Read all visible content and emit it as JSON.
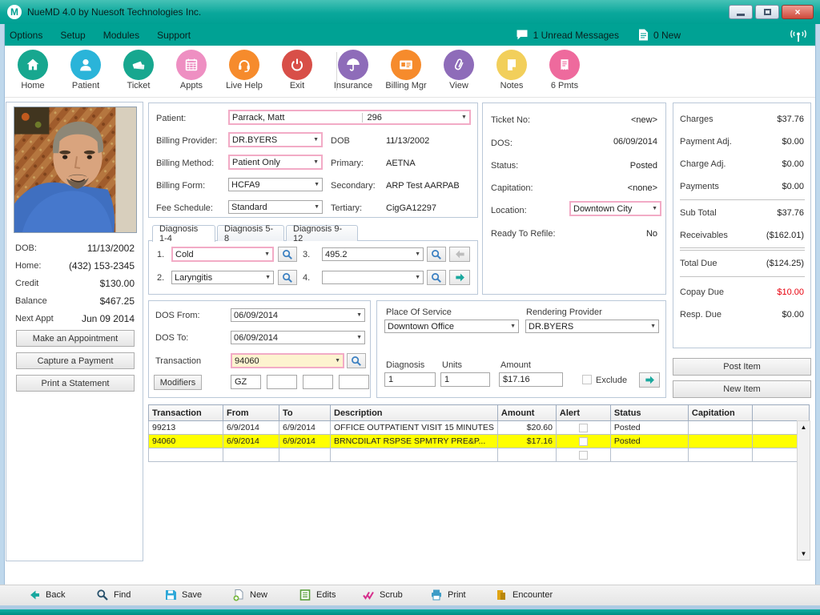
{
  "titlebar": {
    "logo_letter": "M",
    "title": "NueMD 4.0 by Nuesoft Technologies Inc."
  },
  "menubar": {
    "items": [
      "Options",
      "Setup",
      "Modules",
      "Support"
    ],
    "unread": "1 Unread Messages",
    "new_badge": "0 New"
  },
  "toolbar": {
    "items": [
      {
        "label": "Home",
        "color": "#17a78f"
      },
      {
        "label": "Patient",
        "color": "#2ab4d9"
      },
      {
        "label": "Ticket",
        "color": "#17a78f"
      },
      {
        "label": "Appts",
        "color": "#ee8fc2"
      },
      {
        "label": "Live Help",
        "color": "#f68b2c"
      },
      {
        "label": "Exit",
        "color": "#d84f48"
      },
      {
        "label": "Insurance",
        "color": "#8e6cb9"
      },
      {
        "label": "Billing Mgr",
        "color": "#f68b2c"
      },
      {
        "label": "View",
        "color": "#8e6cb9"
      },
      {
        "label": "Notes",
        "color": "#f2cf5b"
      },
      {
        "label": "6 Pmts",
        "color": "#ee6a9d"
      }
    ]
  },
  "sidebar": {
    "dob_label": "DOB:",
    "dob": "11/13/2002",
    "home_label": "Home:",
    "home": "(432) 153-2345",
    "credit_label": "Credit",
    "credit": "$130.00",
    "balance_label": "Balance",
    "balance": "$467.25",
    "next_appt_label": "Next Appt",
    "next_appt": "Jun 09 2014",
    "buttons": [
      "Make an Appointment",
      "Capture a Payment",
      "Print a Statement"
    ]
  },
  "patient_form": {
    "patient_label": "Patient:",
    "patient_name": "Parrack, Matt",
    "patient_number": "296",
    "billing_provider_label": "Billing Provider:",
    "billing_provider": "DR.BYERS",
    "dob_label": "DOB",
    "dob": "11/13/2002",
    "billing_method_label": "Billing Method:",
    "billing_method": "Patient Only",
    "primary_label": "Primary:",
    "primary": "AETNA",
    "billing_form_label": "Billing Form:",
    "billing_form": "HCFA9",
    "secondary_label": "Secondary:",
    "secondary": "ARP Test AARPAB",
    "fee_schedule_label": "Fee Schedule:",
    "fee_schedule": "Standard",
    "tertiary_label": "Tertiary:",
    "tertiary": "CigGA12297"
  },
  "diagnosis": {
    "tabs": [
      "Diagnosis 1-4",
      "Diagnosis 5-8",
      "Diagnosis 9-12"
    ],
    "f1_num": "1.",
    "f1": "Cold",
    "f2_num": "2.",
    "f2": "Laryngitis",
    "f3_num": "3.",
    "f3": "495.2",
    "f4_num": "4.",
    "f4": ""
  },
  "ticket": {
    "ticket_no_label": "Ticket No:",
    "ticket_no": "<new>",
    "dos_label": "DOS:",
    "dos": "06/09/2014",
    "status_label": "Status:",
    "status": "Posted",
    "capitation_label": "Capitation:",
    "capitation": "<none>",
    "location_label": "Location:",
    "location": "Downtown City",
    "refile_label": "Ready To Refile:",
    "refile": "No"
  },
  "financials": {
    "charges_label": "Charges",
    "charges": "$37.76",
    "payment_adj_label": "Payment Adj.",
    "payment_adj": "$0.00",
    "charge_adj_label": "Charge Adj.",
    "charge_adj": "$0.00",
    "payments_label": "Payments",
    "payments": "$0.00",
    "sub_total_label": "Sub Total",
    "sub_total": "$37.76",
    "receivables_label": "Receivables",
    "receivables": "($162.01)",
    "total_due_label": "Total Due",
    "total_due": "($124.25)",
    "copay_due_label": "Copay Due",
    "copay_due": "$10.00",
    "resp_due_label": "Resp. Due",
    "resp_due": "$0.00",
    "post_item": "Post Item",
    "new_item": "New Item"
  },
  "charge": {
    "dos_from_label": "DOS From:",
    "dos_from": "06/09/2014",
    "dos_to_label": "DOS To:",
    "dos_to": "06/09/2014",
    "transaction_label": "Transaction",
    "transaction": "94060",
    "modifiers_label": "Modifiers",
    "modifier_1": "GZ",
    "modifier_2": "",
    "modifier_3": "",
    "modifier_4": "",
    "pos_label": "Place Of Service",
    "pos": "Downtown Office",
    "provider_label": "Rendering Provider",
    "provider": "DR.BYERS",
    "diagnosis_label": "Diagnosis",
    "diagnosis": "1",
    "units_label": "Units",
    "units": "1",
    "amount_label": "Amount",
    "amount": "$17.16",
    "exclude_label": "Exclude"
  },
  "table": {
    "columns": [
      "Transaction",
      "From",
      "To",
      "Description",
      "Amount",
      "Alert",
      "Status",
      "Capitation",
      ""
    ],
    "rows": [
      {
        "transaction": "99213",
        "from": "6/9/2014",
        "to": "6/9/2014",
        "description": "OFFICE OUTPATIENT VISIT 15 MINUTES",
        "amount": "$20.60",
        "status": "Posted",
        "capitation": ""
      },
      {
        "transaction": "94060",
        "from": "6/9/2014",
        "to": "6/9/2014",
        "description": "BRNCDILAT RSPSE SPMTRY PRE&P...",
        "amount": "$17.16",
        "status": "Posted",
        "capitation": ""
      }
    ]
  },
  "bottombar": {
    "items": [
      "Back",
      "Find",
      "Save",
      "New",
      "Edits",
      "Scrub",
      "Print",
      "Encounter"
    ]
  },
  "colors": {
    "teal": "#00a79b",
    "menu_teal": "#00a294",
    "selected_row": "#ffff00",
    "copay_red": "#e8000d",
    "highlight_border": "#f2abc6"
  }
}
